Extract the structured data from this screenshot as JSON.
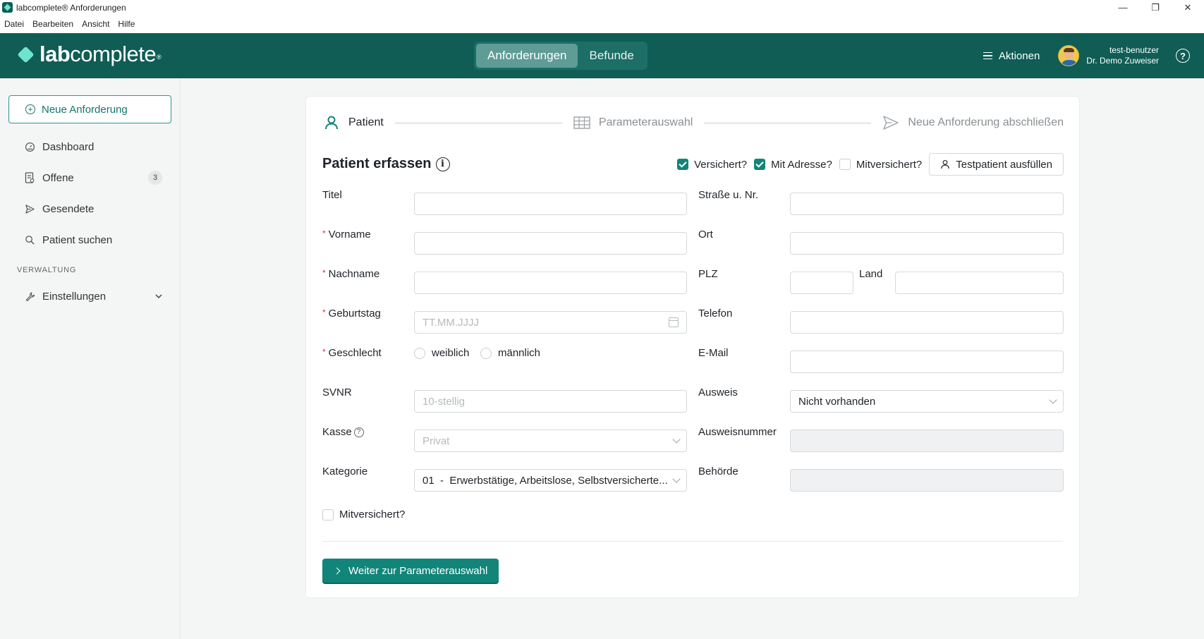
{
  "window": {
    "title": "labcomplete® Anforderungen",
    "controls": [
      "—",
      "❐",
      "✕"
    ]
  },
  "menu": [
    "Datei",
    "Bearbeiten",
    "Ansicht",
    "Hilfe"
  ],
  "header": {
    "logo_bold": "lab",
    "logo_rest": "complete",
    "logo_mark": "®",
    "tabs": [
      {
        "label": "Anforderungen",
        "active": true
      },
      {
        "label": "Befunde",
        "active": false
      }
    ],
    "actions_label": "Aktionen",
    "user_name": "test-benutzer",
    "user_role": "Dr. Demo Zuweiser",
    "help": "?"
  },
  "sidebar": {
    "new_request": "Neue Anforderung",
    "items": [
      {
        "label": "Dashboard",
        "icon": "dashboard-icon"
      },
      {
        "label": "Offene",
        "icon": "document-icon",
        "badge": "3"
      },
      {
        "label": "Gesendete",
        "icon": "send-icon"
      },
      {
        "label": "Patient suchen",
        "icon": "search-icon"
      }
    ],
    "section_title": "VERWALTUNG",
    "settings": "Einstellungen"
  },
  "steps": [
    {
      "label": "Patient",
      "icon": "user-icon",
      "active": true
    },
    {
      "label": "Parameterauswahl",
      "icon": "table-icon",
      "active": false
    },
    {
      "label": "Neue Anforderung abschließen",
      "icon": "send-icon",
      "active": false
    }
  ],
  "form": {
    "title": "Patient erfassen",
    "options": [
      {
        "label": "Versichert?",
        "checked": true
      },
      {
        "label": "Mit Adresse?",
        "checked": true
      },
      {
        "label": "Mitversichert?",
        "checked": false
      }
    ],
    "fill_test_button": "Testpatient ausfüllen",
    "left": {
      "titel": {
        "label": "Titel",
        "value": ""
      },
      "vorname": {
        "label": "Vorname",
        "value": ""
      },
      "nachname": {
        "label": "Nachname",
        "value": ""
      },
      "geburtstag": {
        "label": "Geburtstag",
        "placeholder": "TT.MM.JJJJ"
      },
      "geschlecht": {
        "label": "Geschlecht",
        "options": [
          "weiblich",
          "männlich"
        ]
      },
      "svnr": {
        "label": "SVNR",
        "placeholder": "10-stellig"
      },
      "kasse": {
        "label": "Kasse",
        "placeholder": "Privat"
      },
      "kategorie": {
        "label": "Kategorie",
        "value": "01  -  Erwerbstätige, Arbeitslose, Selbstversicherte..."
      }
    },
    "right": {
      "strasse": {
        "label": "Straße u. Nr.",
        "value": ""
      },
      "ort": {
        "label": "Ort",
        "value": ""
      },
      "plz": {
        "label": "PLZ",
        "value": ""
      },
      "land": {
        "label": "Land",
        "value": ""
      },
      "telefon": {
        "label": "Telefon",
        "value": ""
      },
      "email": {
        "label": "E-Mail",
        "value": ""
      },
      "ausweis": {
        "label": "Ausweis",
        "value": "Nicht vorhanden"
      },
      "ausweisnummer": {
        "label": "Ausweisnummer",
        "value": ""
      },
      "behoerde": {
        "label": "Behörde",
        "value": ""
      }
    },
    "mitversichert_label": "Mitversichert?",
    "submit": "Weiter zur Parameterauswahl"
  },
  "colors": {
    "brand": "#0f5d55",
    "accent": "#12857a",
    "logo_mark": "#6fe3cc"
  }
}
